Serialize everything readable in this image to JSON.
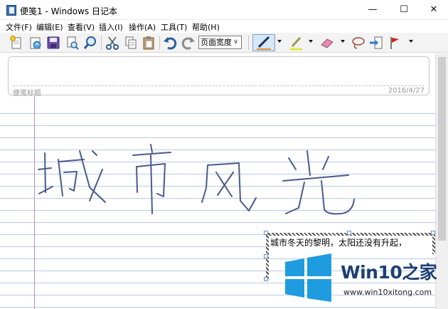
{
  "window": {
    "title": "便笺1 - Windows 日记本",
    "minimize_glyph": "—",
    "maximize_glyph": "☐",
    "close_glyph": "✕"
  },
  "menu": [
    "文件(F)",
    "编辑(E)",
    "查看(V)",
    "插入(I)",
    "操作(A)",
    "工具(T)",
    "帮助(H)"
  ],
  "toolbar": {
    "zoom_value": "页面宽度",
    "buttons": [
      "new-note-icon",
      "open-icon",
      "save-icon",
      "print-preview-icon",
      "find-icon",
      "cut-icon",
      "copy-icon",
      "paste-icon",
      "undo-icon",
      "redo-icon",
      "pen-icon",
      "highlighter-icon",
      "eraser-icon",
      "lasso-icon",
      "insert-space-icon",
      "flag-icon"
    ],
    "colors": {
      "pen": "#1a2f5a",
      "pen_underline": "#e0912a",
      "highlighter": "#e6e64a",
      "eraser": "#e88bb2",
      "flag": "#d42020"
    }
  },
  "note": {
    "title_placeholder": "便笺标题",
    "date": "2016/4/27",
    "handwriting": "城市风光",
    "text_box": "城市冬天的黎明，太阳还没有升起，"
  },
  "watermark": {
    "brand_prefix": "Win10",
    "brand_suffix": "之家",
    "url": "www.win10xitong.com",
    "colors": {
      "logo": "#1f9be0",
      "text": "#1d3f73"
    }
  }
}
